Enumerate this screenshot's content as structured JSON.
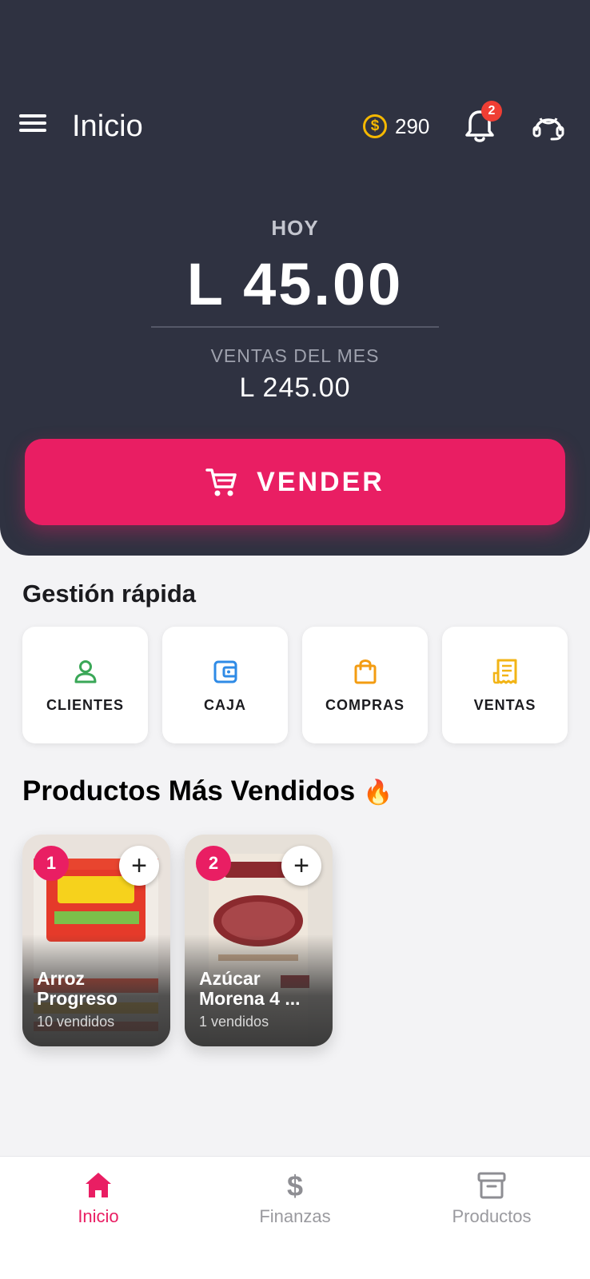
{
  "header": {
    "title": "Inicio",
    "coins": "290",
    "notifications_count": "2"
  },
  "summary": {
    "today_label": "HOY",
    "today_amount": "L 45.00",
    "month_label": "VENTAS DEL MES",
    "month_amount": "L 245.00"
  },
  "sell_button": {
    "label": "VENDER"
  },
  "quick": {
    "title": "Gestión rápida",
    "items": [
      {
        "label": "CLIENTES",
        "icon": "user-icon",
        "color": "#3aa757"
      },
      {
        "label": "CAJA",
        "icon": "wallet-icon",
        "color": "#2f8be6"
      },
      {
        "label": "COMPRAS",
        "icon": "shopping-bag-icon",
        "color": "#f39c12"
      },
      {
        "label": "VENTAS",
        "icon": "receipt-icon",
        "color": "#f2b416"
      }
    ]
  },
  "products": {
    "title": "Productos Más Vendidos",
    "title_emoji": "🔥",
    "items": [
      {
        "rank": "1",
        "name": "Arroz Progreso",
        "sold": "10 vendidos"
      },
      {
        "rank": "2",
        "name": "Azúcar Morena 4 ...",
        "sold": "1 vendidos"
      }
    ]
  },
  "nav": {
    "items": [
      {
        "label": "Inicio",
        "icon": "home-icon",
        "active": true
      },
      {
        "label": "Finanzas",
        "icon": "dollar-icon",
        "active": false
      },
      {
        "label": "Productos",
        "icon": "archive-box-icon",
        "active": false
      }
    ]
  },
  "colors": {
    "accent": "#e91e63",
    "header_bg": "#2f3241",
    "page_bg": "#f3f3f5"
  }
}
